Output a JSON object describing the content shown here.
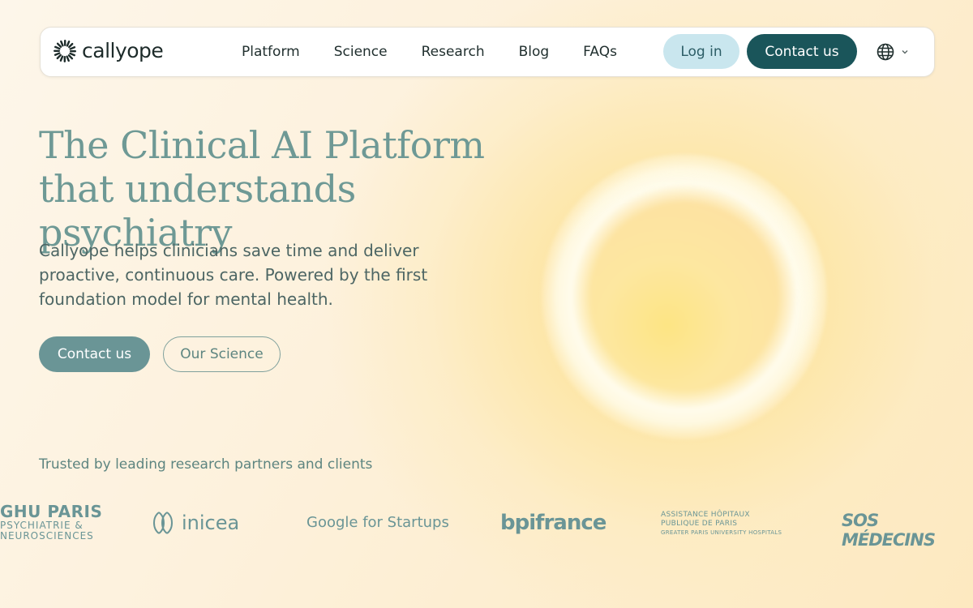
{
  "brand": {
    "name": "callyope"
  },
  "nav": {
    "links": [
      "Platform",
      "Science",
      "Research",
      "Blog",
      "FAQs"
    ],
    "login_label": "Log in",
    "contact_label": "Contact us",
    "language_icon": "globe-icon"
  },
  "hero": {
    "title_line1": "The Clinical AI Platform",
    "title_line2": "that understands psychiatry",
    "subtitle": "Callyope helps clinicians save time and deliver proactive, continuous care. Powered by the first foundation model for mental health.",
    "primary_cta": "Contact us",
    "secondary_cta": "Our Science"
  },
  "partners": {
    "heading": "Trusted by leading research partners and clients",
    "ghu": {
      "name": "GHU PARIS",
      "line2": "PSYCHIATRIE &",
      "line3": "NEUROSCIENCES"
    },
    "inicea": "inicea",
    "google": "Google for Startups",
    "bpi": "bpifrance",
    "aphp": {
      "line1": "ASSISTANCE  HÔPITAUX",
      "line2": "PUBLIQUE    DE PARIS",
      "line3": "GREATER PARIS UNIVERSITY HOSPITALS"
    },
    "sos": "SOS MÉDECINS"
  },
  "colors": {
    "accent_dark": "#1a555a",
    "accent_teal": "#6a9596",
    "login_bg": "#c9e6ee"
  }
}
